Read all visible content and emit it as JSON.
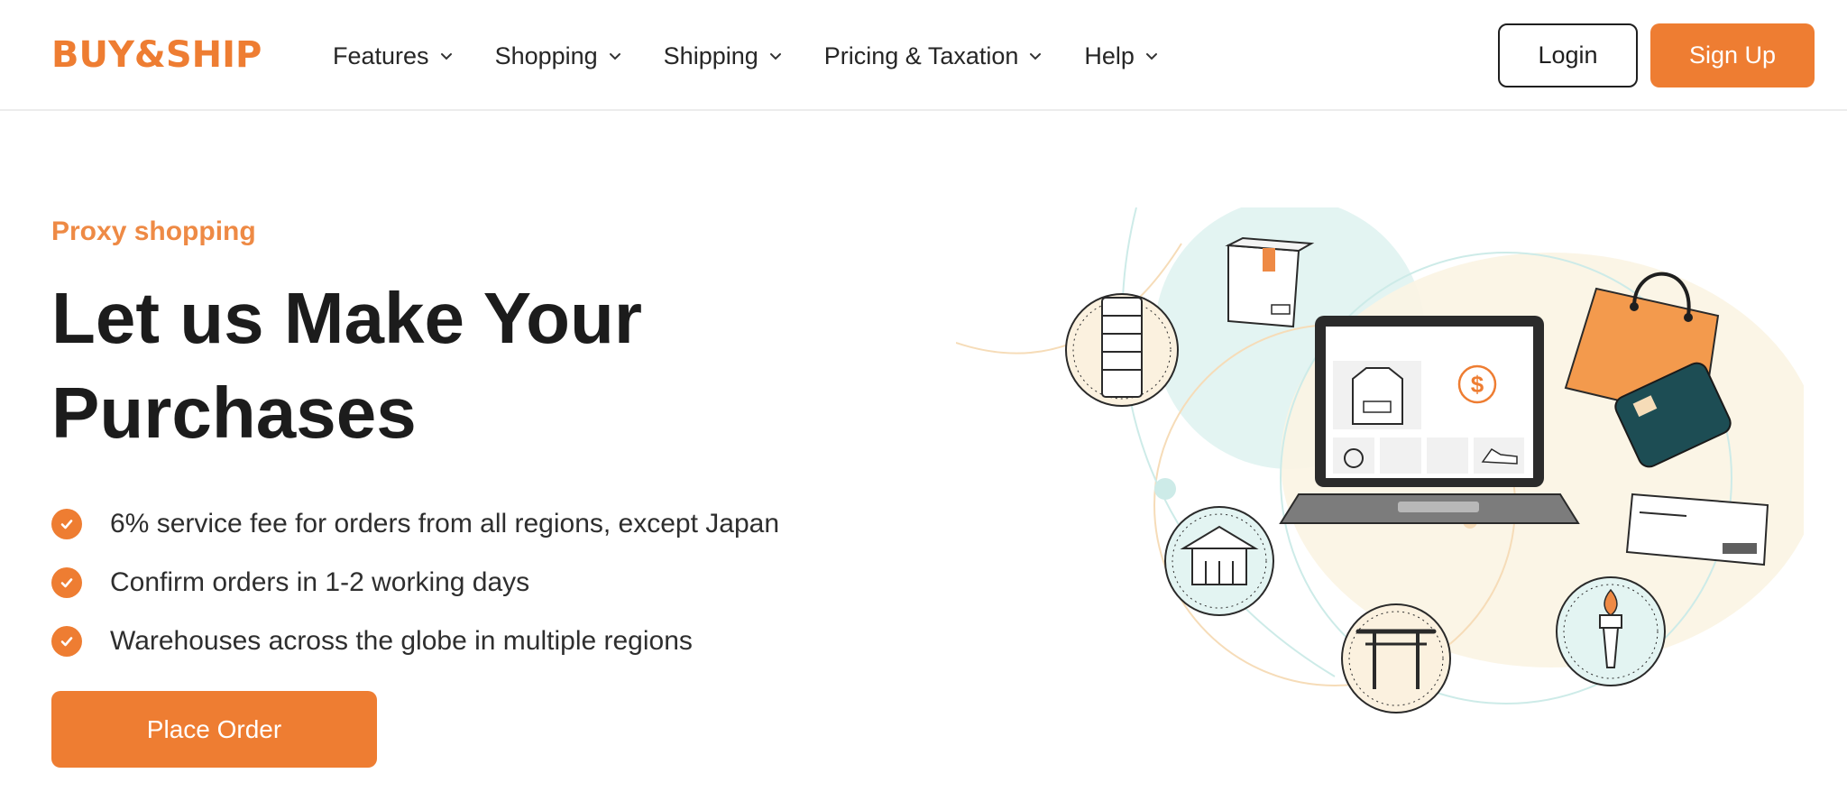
{
  "header": {
    "logo_text": "BUY&SHIP",
    "nav": [
      {
        "label": "Features"
      },
      {
        "label": "Shopping"
      },
      {
        "label": "Shipping"
      },
      {
        "label": "Pricing & Taxation"
      },
      {
        "label": "Help"
      }
    ],
    "login_label": "Login",
    "signup_label": "Sign Up"
  },
  "hero": {
    "eyebrow": "Proxy shopping",
    "headline_line1": "Let us Make Your",
    "headline_line2": "Purchases",
    "features": [
      "6% service fee for orders from all regions, except Japan",
      "Confirm orders in 1-2 working days",
      "Warehouses across the globe in multiple regions"
    ],
    "cta_label": "Place Order"
  },
  "colors": {
    "brand_orange": "#ee7d32",
    "text_dark": "#1c1c1c",
    "teal_light": "#d6f0ef",
    "cream": "#fbf1df"
  },
  "icons": [
    "chevron-down-icon",
    "check-icon",
    "leaning-tower-icon",
    "japanese-castle-icon",
    "torii-gate-icon",
    "torch-icon",
    "laptop-icon",
    "shopping-bag-icon",
    "credit-card-icon",
    "package-box-icon",
    "envelope-icon",
    "hoodie-icon",
    "dollar-icon",
    "watch-icon",
    "sneaker-icon"
  ]
}
